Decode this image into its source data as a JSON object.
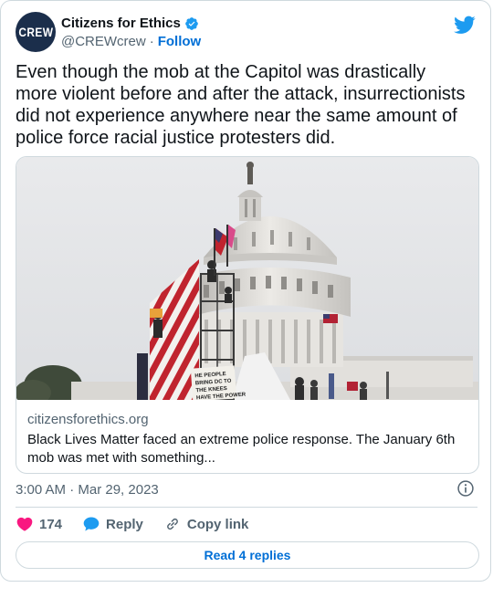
{
  "author": {
    "avatar_text": "CREW",
    "name": "Citizens for Ethics",
    "handle": "@CREWcrew",
    "separator": "·",
    "follow_label": "Follow"
  },
  "tweet": {
    "text": "Even though the mob at the Capitol was drastically more violent before and after the attack, insurrectionists did not experience anywhere near the same amount of police force racial justice protesters did.",
    "timestamp": "3:00 AM · Mar 29, 2023"
  },
  "link_card": {
    "domain": "citizensforethics.org",
    "title": "Black Lives Matter faced an extreme police response. The January 6th mob was met with something...",
    "sign_text": [
      "HE PEOPLE",
      "BRING DC TO",
      "THE KNEES",
      "HAVE THE POWER"
    ]
  },
  "actions": {
    "like_count": "174",
    "reply_label": "Reply",
    "copy_label": "Copy link"
  },
  "read_replies_label": "Read 4 replies",
  "colors": {
    "brand_blue": "#1d9bf0",
    "link_blue": "#006fd6",
    "like_pink": "#f91880",
    "muted": "#536471",
    "avatar_bg": "#1b2e4b"
  },
  "icons": [
    "verified-badge-icon",
    "twitter-bird-icon",
    "info-icon",
    "heart-icon",
    "reply-bubble-icon",
    "link-icon"
  ]
}
